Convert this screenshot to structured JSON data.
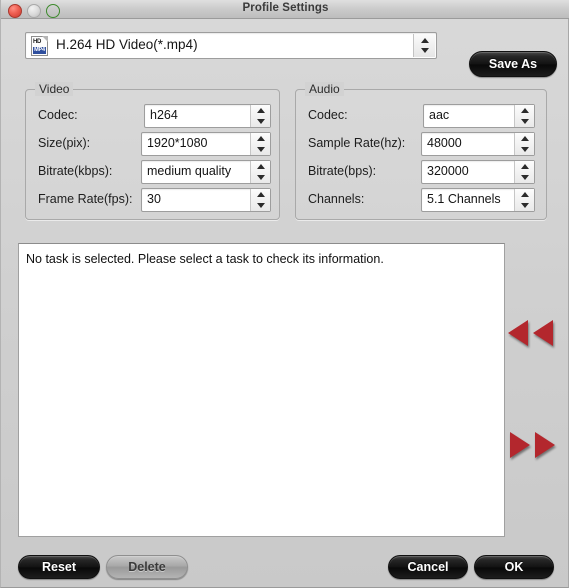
{
  "window": {
    "title": "Profile Settings",
    "controls": {
      "close": "close-button",
      "minimize": "minimize-button",
      "zoom": "zoom-button"
    }
  },
  "profile": {
    "icon": "h264-mp4-file-icon",
    "icon_hd_label": "HD",
    "icon_format_label": "MP4",
    "selected": "H.264 HD Video(*.mp4)",
    "save_as_label": "Save As"
  },
  "video": {
    "title": "Video",
    "fields": [
      {
        "label": "Codec:",
        "value": "h264"
      },
      {
        "label": "Size(pix):",
        "value": "1920*1080"
      },
      {
        "label": "Bitrate(kbps):",
        "value": "medium quality"
      },
      {
        "label": "Frame Rate(fps):",
        "value": "30"
      }
    ]
  },
  "audio": {
    "title": "Audio",
    "fields": [
      {
        "label": "Codec:",
        "value": "aac"
      },
      {
        "label": "Sample Rate(hz):",
        "value": "48000"
      },
      {
        "label": "Bitrate(bps):",
        "value": "320000"
      },
      {
        "label": "Channels:",
        "value": "5.1 Channels"
      }
    ]
  },
  "info": {
    "message": "No task is selected. Please select a task to check its information."
  },
  "navigation": {
    "prev_icon": "double-left-arrow-icon",
    "next_icon": "double-right-arrow-icon",
    "arrow_color": "#b3272d"
  },
  "footer": {
    "reset_label": "Reset",
    "delete_label": "Delete",
    "cancel_label": "Cancel",
    "ok_label": "OK",
    "delete_disabled": true
  }
}
